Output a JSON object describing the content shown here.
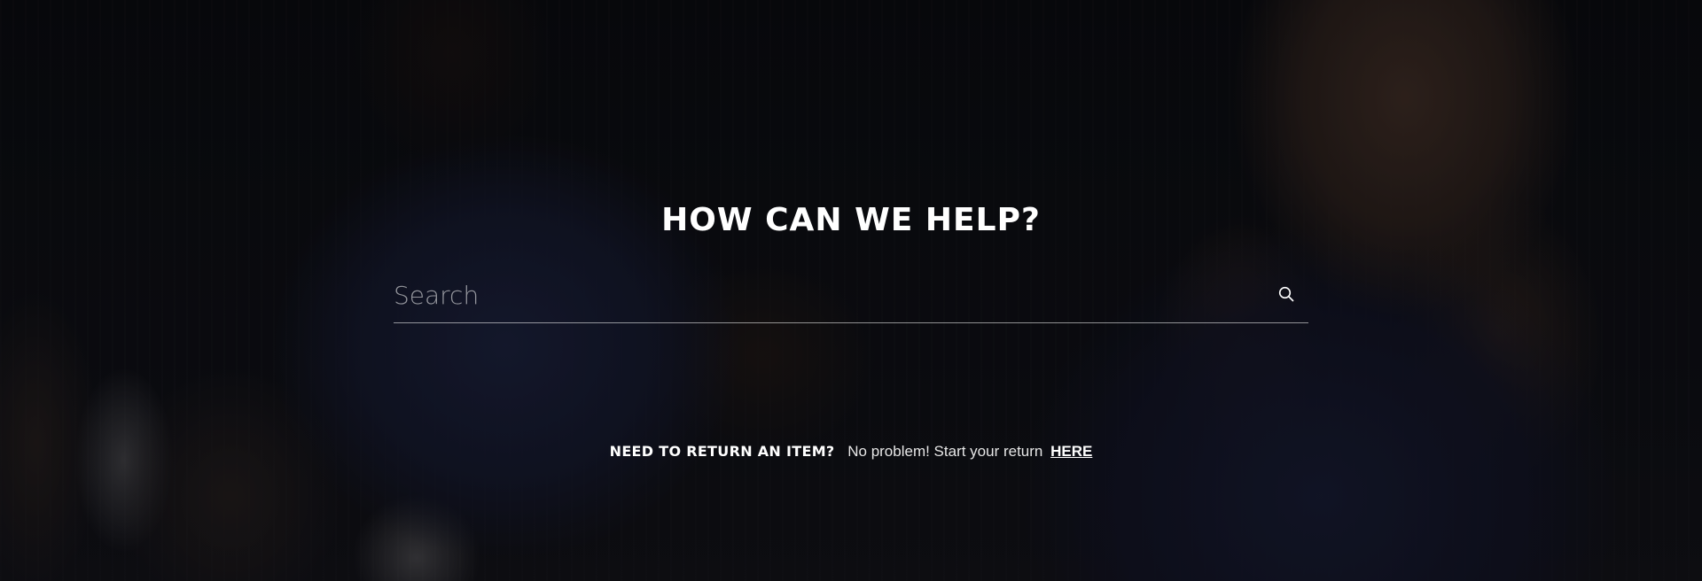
{
  "help": {
    "title": "HOW CAN WE HELP?"
  },
  "search": {
    "placeholder": "Search",
    "value": "",
    "icon": "search-icon"
  },
  "returns": {
    "heading": "NEED TO RETURN AN ITEM?",
    "text": "No problem! Start your return",
    "link_label": "HERE"
  },
  "colors": {
    "text": "#ffffff",
    "background": "#0c0d12",
    "underline": "#8c8c8c"
  }
}
